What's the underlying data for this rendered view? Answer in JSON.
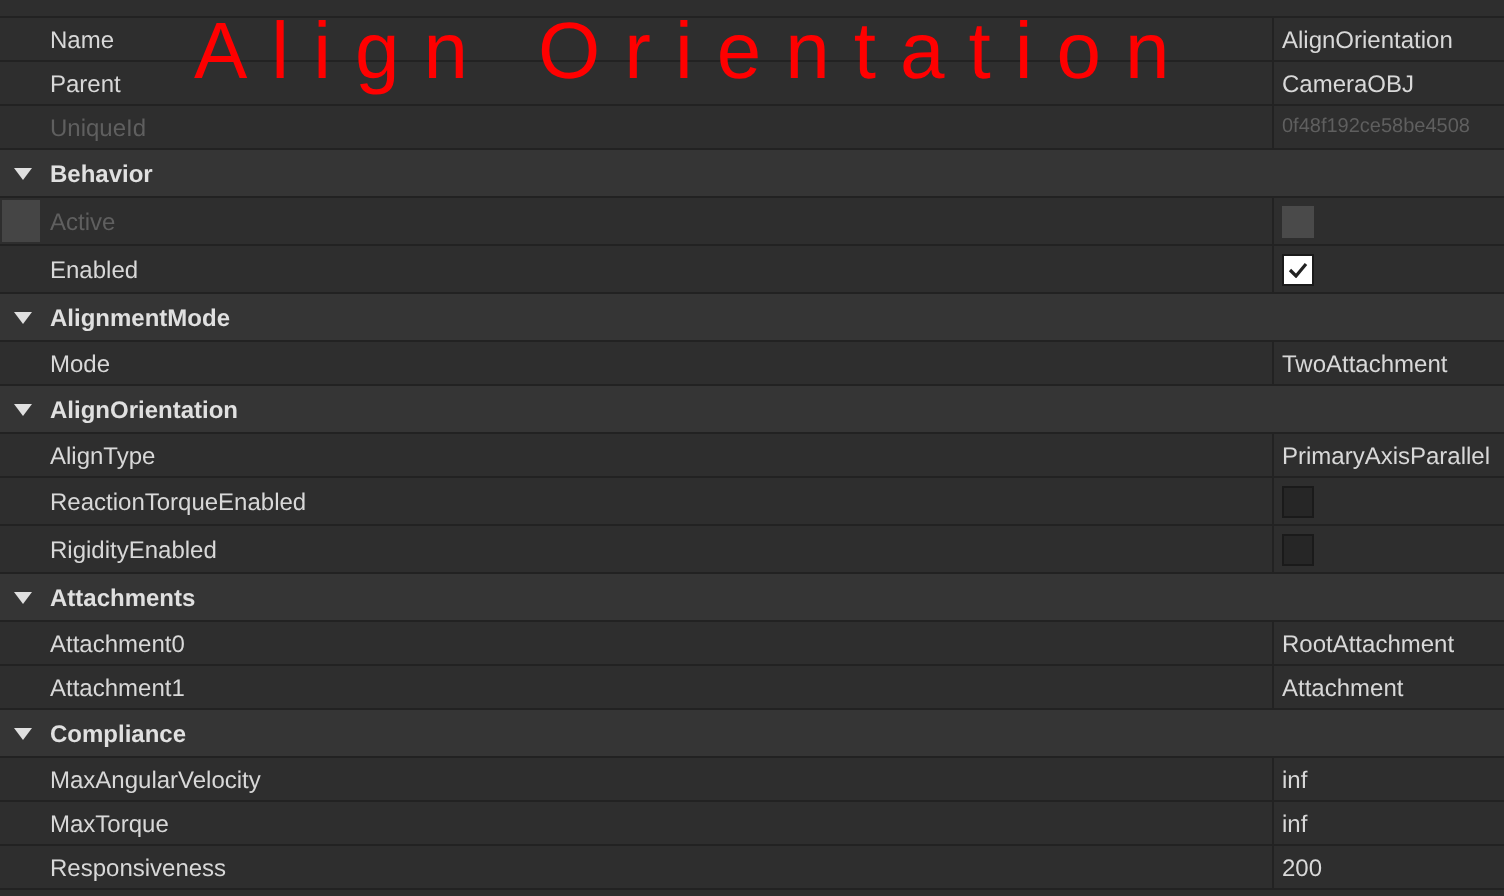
{
  "annotation": "Align Orientation",
  "sections": [
    {
      "properties": [
        {
          "kind": "text",
          "name": "Name",
          "value": "AlignOrientation",
          "disabled": false
        },
        {
          "kind": "text",
          "name": "Parent",
          "value": "CameraOBJ",
          "disabled": false
        },
        {
          "kind": "text",
          "name": "UniqueId",
          "value": "0f48f192ce58be4508",
          "disabled": true
        }
      ]
    },
    {
      "title": "Behavior",
      "expanded": true,
      "properties": [
        {
          "kind": "checkbox",
          "name": "Active",
          "checked": false,
          "disabled": true
        },
        {
          "kind": "checkbox",
          "name": "Enabled",
          "checked": true,
          "disabled": false
        }
      ]
    },
    {
      "title": "AlignmentMode",
      "expanded": true,
      "properties": [
        {
          "kind": "text",
          "name": "Mode",
          "value": "TwoAttachment",
          "disabled": false
        }
      ]
    },
    {
      "title": "AlignOrientation",
      "expanded": true,
      "properties": [
        {
          "kind": "text",
          "name": "AlignType",
          "value": "PrimaryAxisParallel",
          "disabled": false
        },
        {
          "kind": "checkbox",
          "name": "ReactionTorqueEnabled",
          "checked": false,
          "disabled": false
        },
        {
          "kind": "checkbox",
          "name": "RigidityEnabled",
          "checked": false,
          "disabled": false
        }
      ]
    },
    {
      "title": "Attachments",
      "expanded": true,
      "properties": [
        {
          "kind": "text",
          "name": "Attachment0",
          "value": "RootAttachment",
          "disabled": false
        },
        {
          "kind": "text",
          "name": "Attachment1",
          "value": "Attachment",
          "disabled": false
        }
      ]
    },
    {
      "title": "Compliance",
      "expanded": true,
      "properties": [
        {
          "kind": "text",
          "name": "MaxAngularVelocity",
          "value": "inf",
          "disabled": false
        },
        {
          "kind": "text",
          "name": "MaxTorque",
          "value": "inf",
          "disabled": false
        },
        {
          "kind": "text",
          "name": "Responsiveness",
          "value": "200",
          "disabled": false
        }
      ]
    }
  ]
}
